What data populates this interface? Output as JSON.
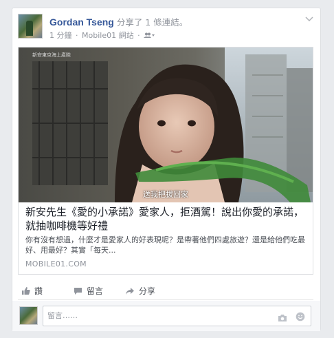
{
  "post": {
    "author": "Gordan Tseng",
    "action": " 分享了 1 條連結。",
    "time": "1 分鐘",
    "separator": "·",
    "source": "Mobile01 網站",
    "privacy_icon": "friends-icon"
  },
  "link": {
    "video_logo": "新安東京海上產險",
    "video_caption": "送我把拔回家",
    "title": "新安先生《愛的小承諾》愛家人，拒酒駕！說出你愛的承諾，就抽咖啡機等好禮",
    "description": "你有沒有想過，什麼才是愛家人的好表現呢？是帶著他們四處旅遊？還是給他們吃最好、用最好？其實「每天...",
    "domain": "MOBILE01.COM"
  },
  "actions": {
    "like": "讚",
    "comment": "留言",
    "share": "分享"
  },
  "comment_box": {
    "placeholder": "留言……"
  },
  "colors": {
    "author_link": "#365899",
    "meta_gray": "#90949c",
    "background": "#e9ebee"
  }
}
